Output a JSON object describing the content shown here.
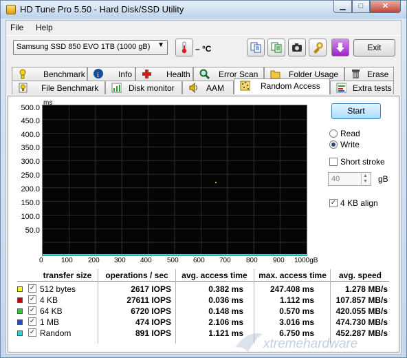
{
  "window": {
    "title": "HD Tune Pro 5.50 - Hard Disk/SSD Utility"
  },
  "menu": [
    {
      "label": "File"
    },
    {
      "label": "Help"
    }
  ],
  "toolbar": {
    "drive": "Samsung SSD 850 EVO 1TB (1000 gB)",
    "temperature": "– °C",
    "exit_label": "Exit"
  },
  "tabs_row1": [
    {
      "label": "Benchmark",
      "icon": "benchmark-icon"
    },
    {
      "label": "Info",
      "icon": "info-icon"
    },
    {
      "label": "Health",
      "icon": "health-icon"
    },
    {
      "label": "Error Scan",
      "icon": "error-scan-icon"
    },
    {
      "label": "Folder Usage",
      "icon": "folder-icon"
    },
    {
      "label": "Erase",
      "icon": "erase-icon"
    }
  ],
  "tabs_row2": [
    {
      "label": "File Benchmark",
      "icon": "file-benchmark-icon"
    },
    {
      "label": "Disk monitor",
      "icon": "disk-monitor-icon"
    },
    {
      "label": "AAM",
      "icon": "speaker-icon"
    },
    {
      "label": "Random Access",
      "icon": "random-access-icon",
      "active": true
    },
    {
      "label": "Extra tests",
      "icon": "extra-tests-icon"
    }
  ],
  "chart": {
    "unit": "ms",
    "y_ticks": [
      "500.0",
      "450.0",
      "400.0",
      "350.0",
      "300.0",
      "250.0",
      "200.0",
      "150.0",
      "100.0",
      "50.0"
    ],
    "x_ticks": [
      "0",
      "100",
      "200",
      "300",
      "400",
      "500",
      "600",
      "700",
      "800",
      "900",
      "1000gB"
    ]
  },
  "controls": {
    "start": "Start",
    "read": "Read",
    "write": "Write",
    "short_stroke": "Short stroke",
    "stroke_value": "40",
    "gb": "gB",
    "align": "4 KB align",
    "write_selected": true,
    "align_checked": true
  },
  "results": {
    "headers": [
      "transfer size",
      "operations / sec",
      "avg. access time",
      "max. access time",
      "avg. speed"
    ],
    "rows": [
      {
        "size": "512 bytes",
        "color": "#ffff00",
        "ops": "2617 IOPS",
        "avg": "0.382 ms",
        "max": "247.408 ms",
        "speed": "1.278 MB/s"
      },
      {
        "size": "4 KB",
        "color": "#d00000",
        "ops": "27611 IOPS",
        "avg": "0.036 ms",
        "max": "1.112 ms",
        "speed": "107.857 MB/s"
      },
      {
        "size": "64 KB",
        "color": "#33cc33",
        "ops": "6720 IOPS",
        "avg": "0.148 ms",
        "max": "0.570 ms",
        "speed": "420.055 MB/s"
      },
      {
        "size": "1 MB",
        "color": "#1f4fd1",
        "ops": "474 IOPS",
        "avg": "2.106 ms",
        "max": "3.016 ms",
        "speed": "474.730 MB/s"
      },
      {
        "size": "Random",
        "color": "#22d8d8",
        "ops": "891 IOPS",
        "avg": "1.121 ms",
        "max": "6.750 ms",
        "speed": "452.287 MB/s"
      }
    ]
  },
  "watermark": "xtremehardware"
}
